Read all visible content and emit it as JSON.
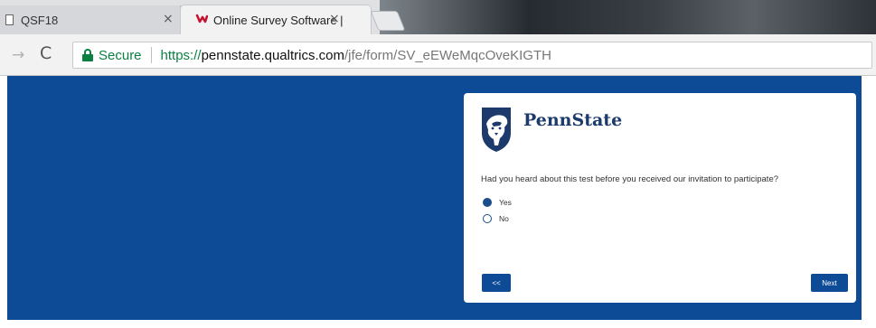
{
  "browser": {
    "tabs": [
      {
        "title": "QSF18",
        "close": "×",
        "active": false,
        "icon": "page-icon"
      },
      {
        "title": "Online Survey Software |",
        "close": "×",
        "active": true,
        "icon": "qualtrics-logo-icon"
      }
    ],
    "toolbar": {
      "back_icon": "→",
      "reload_icon": "C",
      "secure_label": "Secure",
      "url_scheme": "https://",
      "url_host": "pennstate.qualtrics.com",
      "url_path": "/jfe/form/SV_eEWeMqcOveKIGTH"
    }
  },
  "survey": {
    "brand": "PennState",
    "question": "Had you heard about this test before you received our invitation to participate?",
    "choices": [
      {
        "label": "Yes",
        "selected": true
      },
      {
        "label": "No",
        "selected": false
      }
    ],
    "back_label": "<<",
    "next_label": "Next"
  },
  "colors": {
    "background_blue": "#0e4b97",
    "brand_navy": "#1c3a6b",
    "secure_green": "#0b8043"
  }
}
